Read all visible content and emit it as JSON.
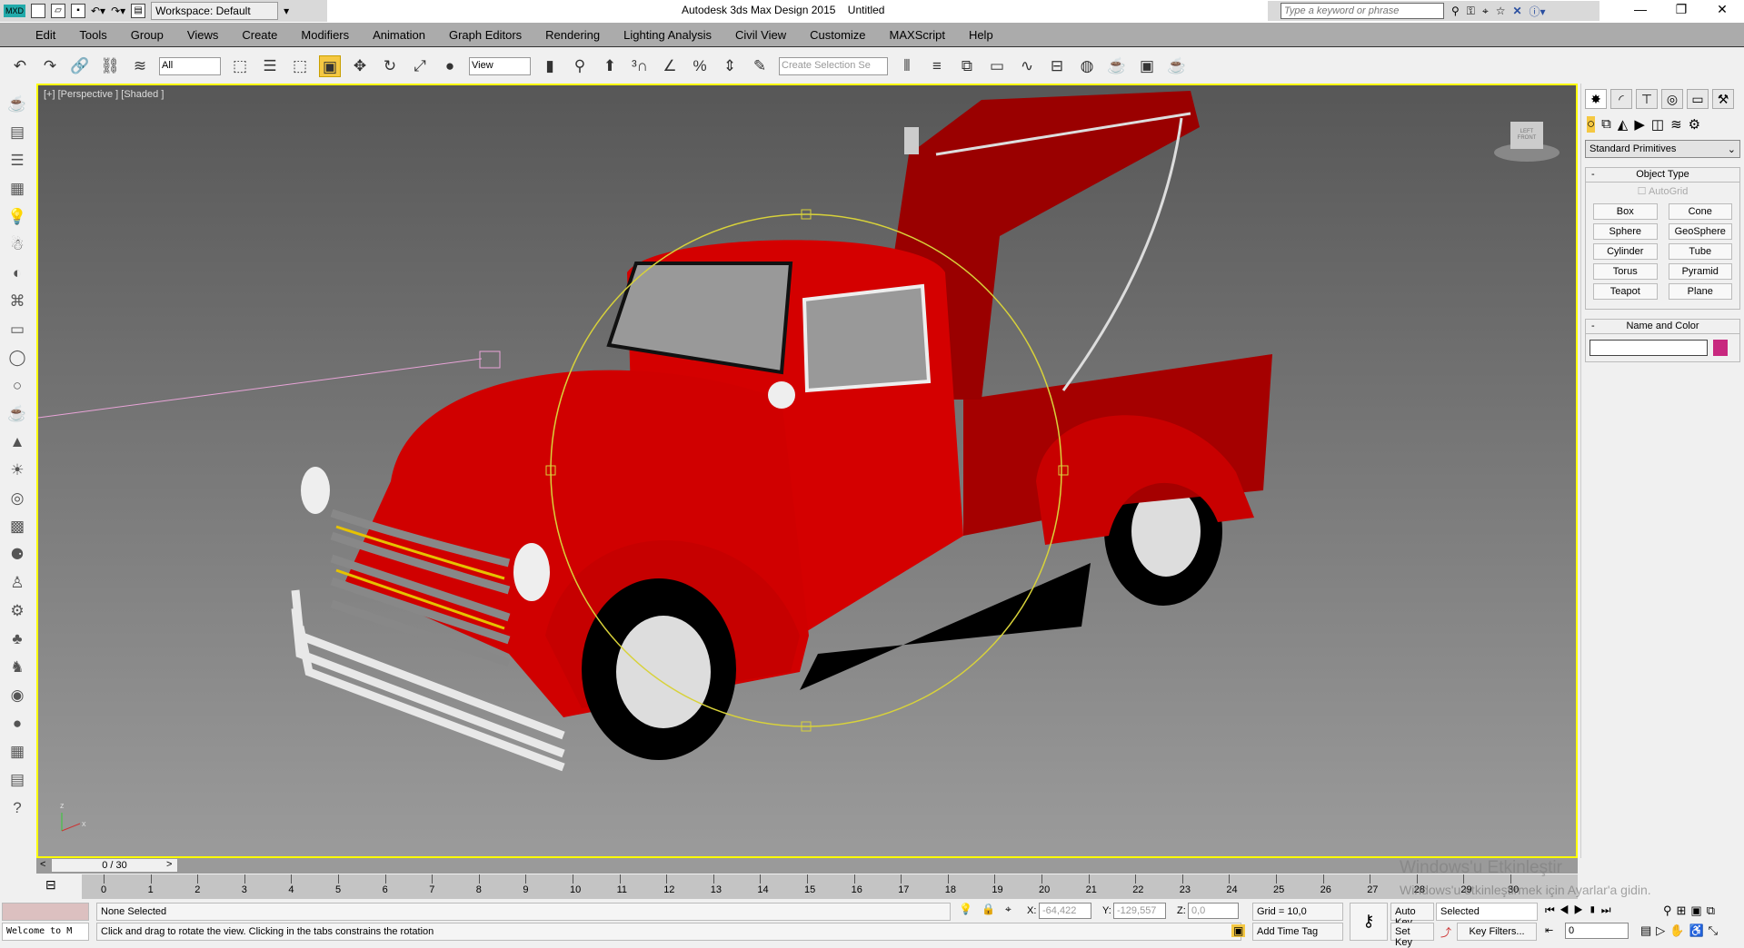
{
  "app": {
    "title": "Autodesk 3ds Max Design 2015",
    "doc": "Untitled",
    "logo": "MXD",
    "workspace": "Workspace: Default",
    "search_placeholder": "Type a keyword or phrase"
  },
  "menu": [
    "Edit",
    "Tools",
    "Group",
    "Views",
    "Create",
    "Modifiers",
    "Animation",
    "Graph Editors",
    "Rendering",
    "Lighting Analysis",
    "Civil View",
    "Customize",
    "MAXScript",
    "Help"
  ],
  "toolbar": {
    "filter": "All",
    "ref_coord": "View",
    "selection_set_placeholder": "Create Selection Se"
  },
  "viewport": {
    "label": "[+] [Perspective ] [Shaded ]",
    "axis_x": "x",
    "axis_z": "z",
    "viewcube": "LEFT FRONT"
  },
  "panel": {
    "dropdown": "Standard Primitives",
    "rollout1": "Object Type",
    "autogrid": "AutoGrid",
    "buttons": [
      "Box",
      "Cone",
      "Sphere",
      "GeoSphere",
      "Cylinder",
      "Tube",
      "Torus",
      "Pyramid",
      "Teapot",
      "Plane"
    ],
    "rollout2": "Name and Color",
    "color": "#c8287f",
    "collapse": "-"
  },
  "timeline": {
    "frame": "0 / 30",
    "ticks": [
      "0",
      "1",
      "2",
      "3",
      "4",
      "5",
      "6",
      "7",
      "8",
      "9",
      "10",
      "11",
      "12",
      "13",
      "14",
      "15",
      "16",
      "17",
      "18",
      "19",
      "20",
      "21",
      "22",
      "23",
      "24",
      "25",
      "26",
      "27",
      "28",
      "29",
      "30"
    ],
    "prev": "<",
    "next": ">"
  },
  "status": {
    "selection": "None Selected",
    "prompt": "Click and drag to rotate the view.  Clicking in the tabs constrains the rotation",
    "listener": "Welcome to M",
    "x_label": "X:",
    "x": "-64,422",
    "y_label": "Y:",
    "y": "-129,557",
    "z_label": "Z:",
    "z": "0,0",
    "grid": "Grid = 10,0",
    "add_time_tag": "Add Time Tag",
    "auto_key": "Auto Key",
    "set_key": "Set Key",
    "key_mode": "Selected",
    "key_filters": "Key Filters...",
    "current_frame": "0"
  },
  "watermark": {
    "line1": "Windows'u Etkinleştir",
    "line2": "Windows'u etkinleştirmek için Ayarlar'a gidin."
  }
}
